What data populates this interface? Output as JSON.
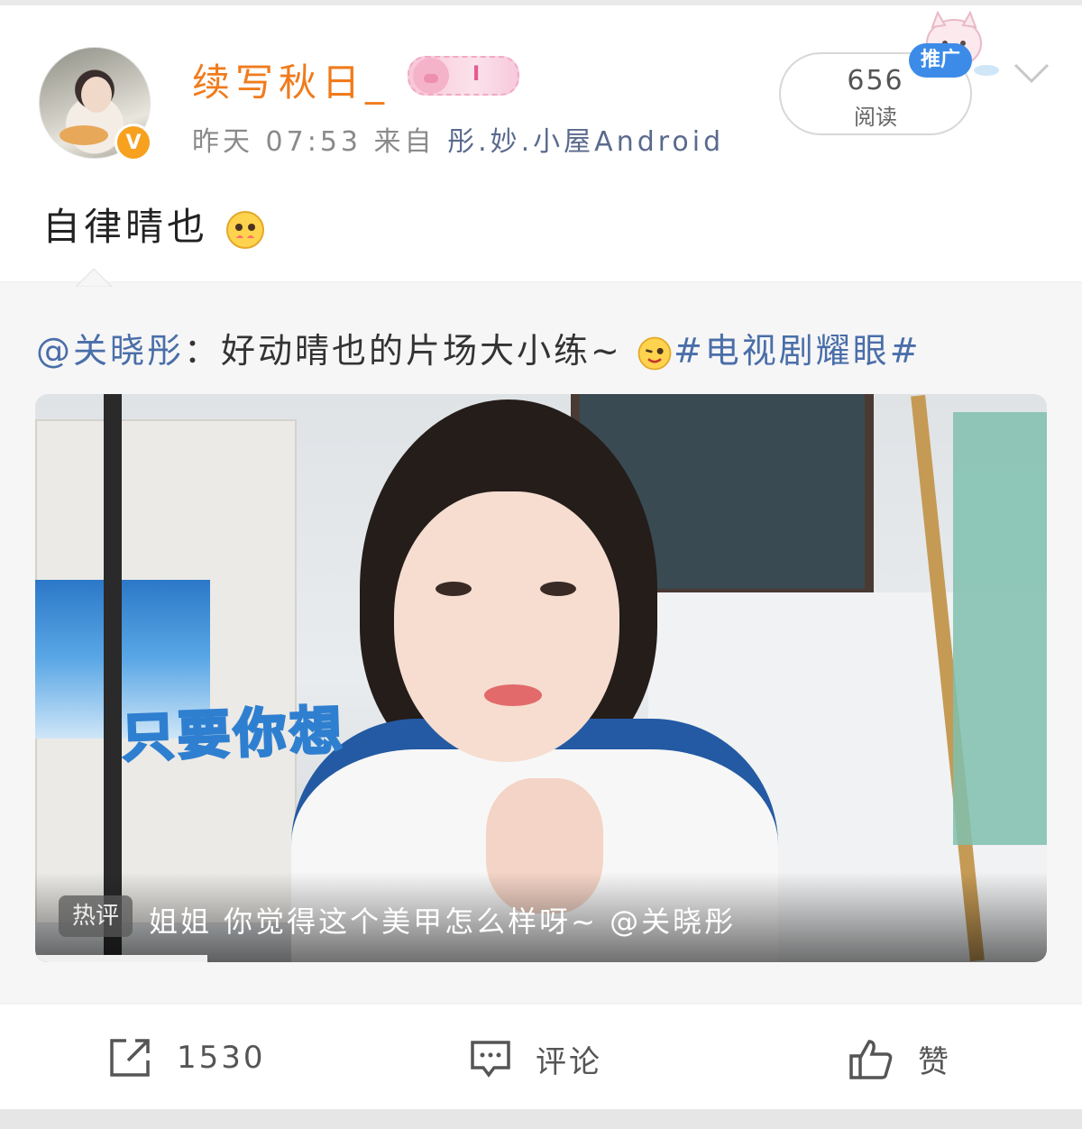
{
  "author": {
    "name": "续写秋日_",
    "badge_level": "I",
    "time": "昨天 07:53",
    "from_label": "来自",
    "source": "彤.妙.小屋Android"
  },
  "stats": {
    "read_count": "656",
    "read_label": "阅读",
    "promo_tag": "推广"
  },
  "post": {
    "text": "自律晴也"
  },
  "repost": {
    "mention": "@关晓彤",
    "text": "：好动晴也的片场大小练~",
    "hashtag": "#电视剧耀眼#"
  },
  "video": {
    "caption": "只要你想",
    "hot_tag": "热评",
    "hot_comment": "姐姐 你觉得这个美甲怎么样呀~ @关晓彤",
    "progress": 0.17
  },
  "actions": {
    "share_count": "1530",
    "comment_label": "评论",
    "like_label": "赞"
  },
  "colors": {
    "username": "#f07b1c",
    "link": "#4a6ea9",
    "promo": "#3c8be8",
    "verified": "#f7a11f"
  }
}
